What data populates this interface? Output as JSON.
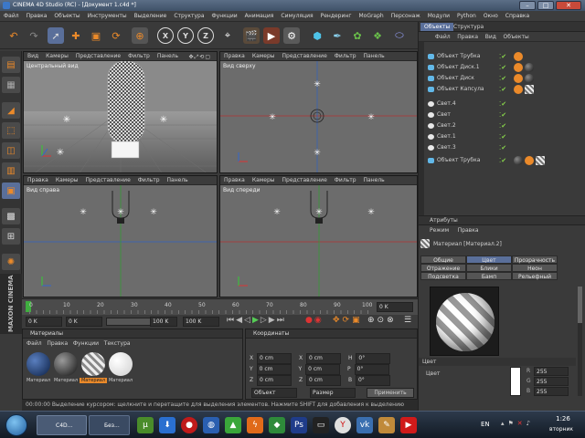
{
  "window": {
    "title": "CINEMA 4D Studio (RC) - [Документ 1.c4d *]",
    "minimize": "–",
    "maximize": "□",
    "close": "✕"
  },
  "menu": [
    "Файл",
    "Правка",
    "Объекты",
    "Инструменты",
    "Выделение",
    "Структура",
    "Функции",
    "Анимация",
    "Симуляция",
    "Рендеринг",
    "MoGraph",
    "Персонаж",
    "Модули",
    "Python",
    "Окно",
    "Справка"
  ],
  "toolbar": {
    "axis_buttons": [
      "X",
      "Y",
      "Z"
    ]
  },
  "viewports": {
    "tl": {
      "menu": [
        "Вид",
        "Камеры",
        "Представление",
        "Фильтр",
        "Панель"
      ],
      "label": "Центральный вид"
    },
    "tr": {
      "menu": [
        "Правка",
        "Камеры",
        "Представление",
        "Фильтр",
        "Панель"
      ],
      "label": "Вид сверху"
    },
    "bl": {
      "menu": [
        "Правка",
        "Камеры",
        "Представление",
        "Фильтр",
        "Панель"
      ],
      "label": "Вид справа"
    },
    "br": {
      "menu": [
        "Правка",
        "Камеры",
        "Представление",
        "Фильтр",
        "Панель"
      ],
      "label": "Вид спереди"
    }
  },
  "timeline": {
    "ticks": [
      "0",
      "10",
      "20",
      "30",
      "40",
      "50",
      "60",
      "70",
      "80",
      "90",
      "100"
    ],
    "frame_end_label": "0 K",
    "current": "0 K",
    "start": "0 K",
    "range_end": "100 K",
    "end": "100 K"
  },
  "materials_panel": {
    "title": "Материалы",
    "menu": [
      "Файл",
      "Правка",
      "Функции",
      "Текстура"
    ],
    "items": [
      {
        "name": "Материал",
        "color": "#1d3f73"
      },
      {
        "name": "Материал",
        "color": "#3a3a3a"
      },
      {
        "name": "Материал",
        "color": "#c8c8c8",
        "selected": true
      },
      {
        "name": "Материал",
        "color": "#f2f2f2"
      }
    ]
  },
  "coords_panel": {
    "title": "Координаты",
    "rows": [
      {
        "a": "X",
        "av": "0 cm",
        "b": "X",
        "bv": "0 cm",
        "c": "H",
        "cv": "0°"
      },
      {
        "a": "Y",
        "av": "0 cm",
        "b": "Y",
        "bv": "0 cm",
        "c": "P",
        "cv": "0°"
      },
      {
        "a": "Z",
        "av": "0 cm",
        "b": "Z",
        "bv": "0 cm",
        "c": "B",
        "cv": "0°"
      }
    ],
    "mode": "Объект",
    "size_mode": "Размер",
    "apply": "Применить"
  },
  "statusbar": "00:00:00  Выделение курсором: щелкните и перетащите для выделения элементов. Нажмите SHIFT для добавления к выделению",
  "objects_panel": {
    "tabs": [
      "Объекты",
      "Структура"
    ],
    "menu": [
      "Файл",
      "Правка",
      "Вид",
      "Объекты"
    ],
    "items": [
      {
        "name": "Объект Трубка",
        "icon": "#62b8e8"
      },
      {
        "name": "Объект Диск.1",
        "icon": "#62b8e8"
      },
      {
        "name": "Объект Диск",
        "icon": "#62b8e8"
      },
      {
        "name": "Объект Капсула",
        "icon": "#62b8e8"
      },
      {
        "name": "Свет.4",
        "icon": "#e8e8e8"
      },
      {
        "name": "Свет",
        "icon": "#e8e8e8"
      },
      {
        "name": "Свет.2",
        "icon": "#e8e8e8"
      },
      {
        "name": "Свет.1",
        "icon": "#e8e8e8"
      },
      {
        "name": "Свет.3",
        "icon": "#e8e8e8"
      },
      {
        "name": "Объект Трубка",
        "icon": "#62b8e8"
      }
    ]
  },
  "attributes_panel": {
    "title": "Атрибуты",
    "menu": [
      "Режим",
      "Правка"
    ],
    "material_label": "Материал [Материал.2]",
    "tabs": [
      [
        "Общие",
        "Цвет",
        "Прозрачность"
      ],
      [
        "Отражение",
        "Блики",
        "Неон"
      ],
      [
        "Подсветка",
        "Бамп",
        "Рельефный"
      ]
    ],
    "color_section": "Цвет",
    "color_label": "Цвет",
    "r": "255",
    "g": "255",
    "b": "255"
  },
  "taskbar": {
    "apps": [
      "C4D...",
      "Без..."
    ],
    "lang": "EN",
    "time": "1:26",
    "day": "вторник"
  }
}
